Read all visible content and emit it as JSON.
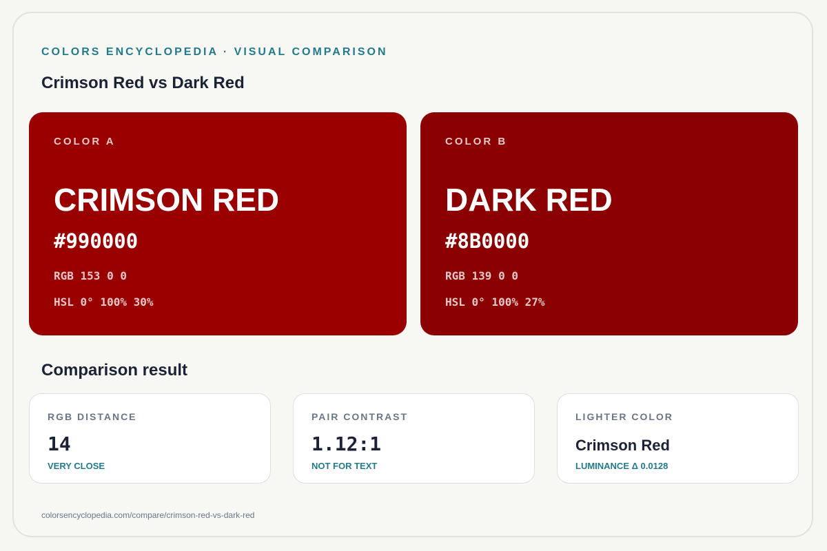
{
  "header": {
    "eyebrow": "COLORS ENCYCLOPEDIA · VISUAL COMPARISON",
    "title": "Crimson Red vs Dark Red"
  },
  "colors": {
    "a": {
      "label": "COLOR A",
      "name": "CRIMSON RED",
      "hex": "#990000",
      "rgb": "RGB 153 0 0",
      "hsl": "HSL 0° 100% 30%",
      "swatch_color": "#990000"
    },
    "b": {
      "label": "COLOR B",
      "name": "DARK RED",
      "hex": "#8B0000",
      "rgb": "RGB 139 0 0",
      "hsl": "HSL 0° 100% 27%",
      "swatch_color": "#8B0000"
    }
  },
  "comparison": {
    "title": "Comparison result",
    "metrics": [
      {
        "label": "RGB DISTANCE",
        "value": "14",
        "note": "VERY CLOSE"
      },
      {
        "label": "PAIR CONTRAST",
        "value": "1.12:1",
        "note": "NOT FOR TEXT"
      },
      {
        "label": "LIGHTER COLOR",
        "value": "Crimson Red",
        "note": "LUMINANCE Δ 0.0128"
      }
    ]
  },
  "footer": {
    "url": "colorsencyclopedia.com/compare/crimson-red-vs-dark-red"
  },
  "theme": {
    "accent": "#247a8a",
    "text_dark": "#1a2233",
    "text_muted": "#6a7687"
  }
}
